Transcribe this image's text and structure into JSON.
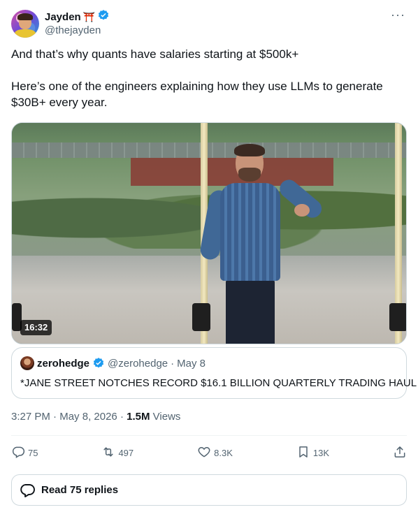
{
  "author": {
    "display_name": "Jayden",
    "emoji": "⛩️",
    "handle": "@thejayden",
    "verified": true
  },
  "more_menu": "···",
  "tweet": {
    "paragraphs": [
      "And that’s why quants have salaries starting at $500k+",
      "Here’s one of the engineers explaining how they use LLMs to generate $30B+ every year."
    ]
  },
  "media": {
    "duration": "16:32"
  },
  "quoted_tweet": {
    "display_name": "zerohedge",
    "handle": "@zerohedge",
    "separator": "·",
    "date": "May 8",
    "text": "*JANE STREET NOTCHES RECORD $16.1 BILLION QUARTERLY TRADING HAUL"
  },
  "timestamp": {
    "time": "3:27 PM",
    "date": "May 8, 2026",
    "views_count": "1.5M",
    "views_label": "Views"
  },
  "actions": {
    "replies": "75",
    "reposts": "497",
    "likes": "8.3K",
    "bookmarks": "13K"
  },
  "read_replies_label": "Read 75 replies",
  "colors": {
    "verified_blue": "#1d9bf0",
    "secondary_text": "#536471",
    "border": "#cfd9de"
  }
}
